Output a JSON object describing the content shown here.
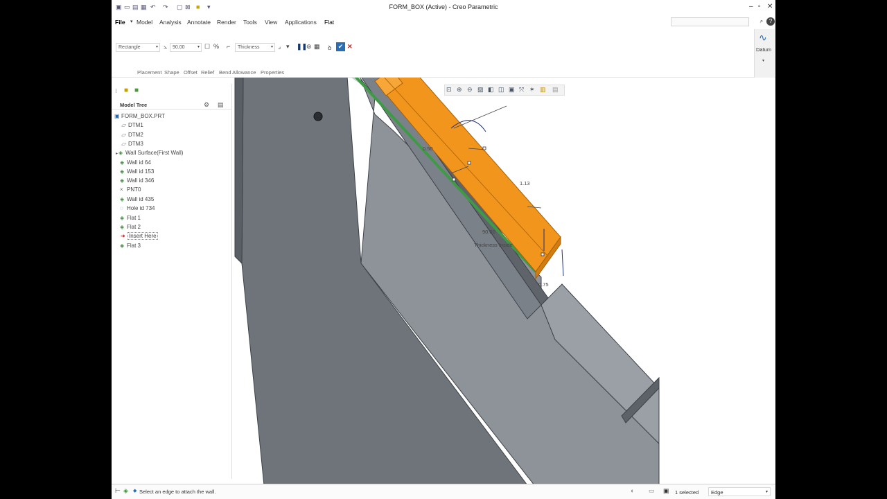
{
  "window": {
    "title": "FORM_BOX (Active) - Creo Parametric"
  },
  "menu": {
    "file": "File",
    "tabs": [
      "Model",
      "Analysis",
      "Annotate",
      "Render",
      "Tools",
      "View",
      "Applications",
      "Flat"
    ],
    "active_tab": "Flat"
  },
  "ribbon": {
    "shape_type": "Rectangle",
    "angle": "90.00",
    "thickness_mode": "Thickness",
    "datum_label": "Datum"
  },
  "subtabs": [
    "Placement",
    "Shape",
    "Offset",
    "Relief",
    "Bend Allowance",
    "Properties"
  ],
  "model_tree": {
    "title": "Model Tree",
    "items": [
      {
        "label": "FORM_BOX.PRT",
        "icon": "part-icon"
      },
      {
        "label": "DTM1",
        "icon": "datum-plane-icon"
      },
      {
        "label": "DTM2",
        "icon": "datum-plane-icon"
      },
      {
        "label": "DTM3",
        "icon": "datum-plane-icon"
      },
      {
        "label": "Wall Surface(First Wall)",
        "icon": "sheetmetal-wall-icon"
      },
      {
        "label": "Wall id 64",
        "icon": "sheetmetal-wall-icon"
      },
      {
        "label": "Wall id 153",
        "icon": "sheetmetal-wall-icon"
      },
      {
        "label": "Wall id 346",
        "icon": "sheetmetal-wall-icon"
      },
      {
        "label": "PNT0",
        "icon": "datum-point-icon"
      },
      {
        "label": "Wall id 435",
        "icon": "sheetmetal-wall-icon"
      },
      {
        "label": "Hole id 734",
        "icon": "hole-icon"
      },
      {
        "label": "Flat 1",
        "icon": "sheetmetal-wall-icon"
      },
      {
        "label": "Flat 2",
        "icon": "sheetmetal-wall-icon"
      },
      {
        "label": "Insert Here",
        "icon": "insert-arrow-icon"
      },
      {
        "label": "Flat 3",
        "icon": "sheetmetal-wall-icon"
      }
    ]
  },
  "viewport": {
    "dimensions": {
      "d1": "0.50",
      "d2": "1.13",
      "d3": "90.00",
      "d4": "Thickness Inside",
      "d5": "0.75"
    }
  },
  "status": {
    "message": "Select an edge to attach the wall.",
    "selected": "1 selected",
    "filter": "Edge"
  },
  "colors": {
    "accent": "#f0961c",
    "model": "#7a7f86"
  }
}
